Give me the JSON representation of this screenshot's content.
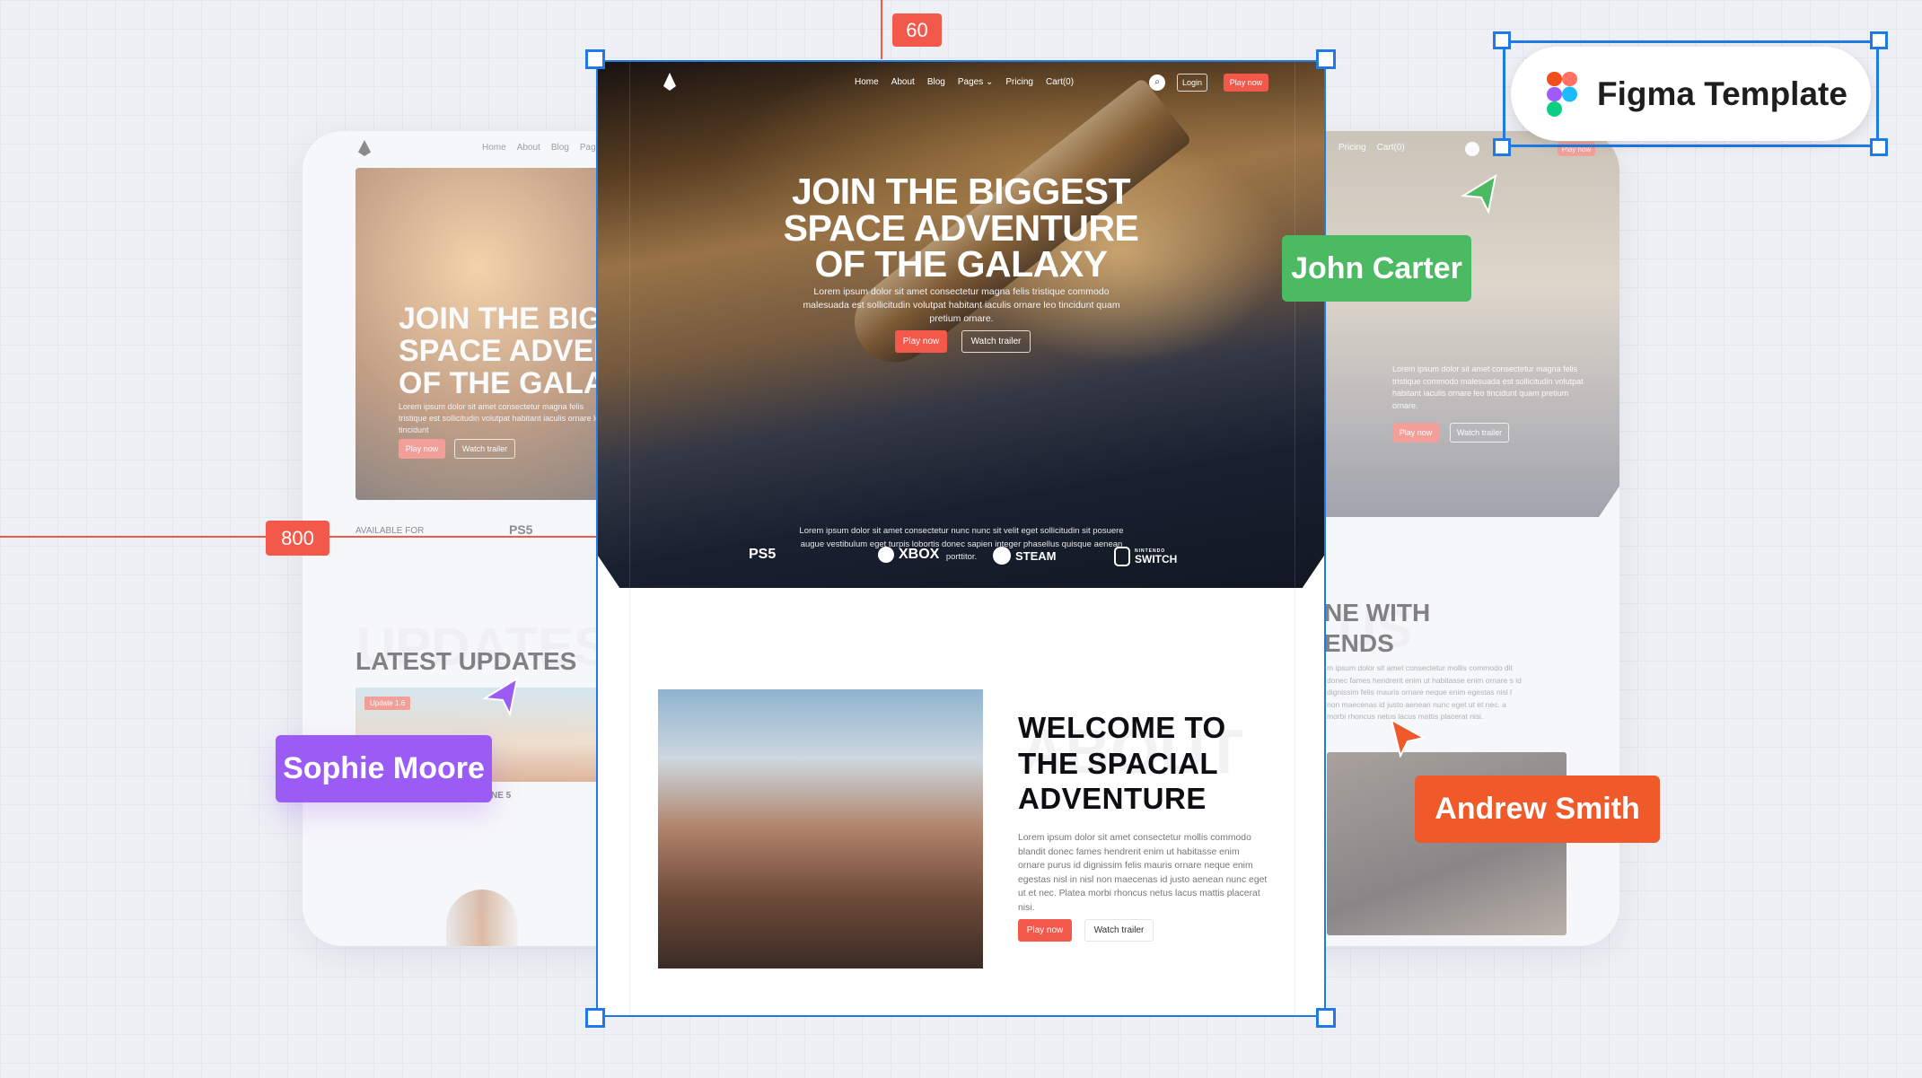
{
  "colors": {
    "accent": "#f2594b",
    "selection": "#1f7ae6",
    "john": "#4cb963",
    "sophie": "#9b5cf6",
    "andrew": "#f0592a"
  },
  "guides": {
    "top_distance": "60",
    "left_distance": "800"
  },
  "badge": {
    "label": "Figma Template",
    "icon": "figma-logo"
  },
  "main": {
    "nav": {
      "logo": "rocket-logo",
      "links": [
        "Home",
        "About",
        "Blog",
        "Pages",
        "Pricing",
        "Cart(0)"
      ],
      "search_icon": "search-icon",
      "login": "Login",
      "play": "Play now"
    },
    "hero": {
      "title_lines": [
        "JOIN THE BIGGEST",
        "SPACE ADVENTURE",
        "OF THE GALAXY"
      ],
      "text": "Lorem ipsum dolor sit amet consectetur magna felis tristique commodo malesuada est sollicitudin volutpat habitant iaculis ornare leo tincidunt quam pretium ornare.",
      "play": "Play now",
      "trailer": "Watch trailer"
    },
    "platforms": [
      "PS5",
      "XBOX",
      "STEAM",
      "SWITCH"
    ],
    "platform_switch_sup": "NINTENDO",
    "platform_text": "Lorem ipsum dolor sit amet consectetur nunc nunc sit velit eget sollicitudin sit posuere augue vestibulum eget turpis lobortis donec sapien integer phasellus quisque aenean porttitor.",
    "about": {
      "ghost": "ABOUT",
      "title_lines": [
        "WELCOME TO",
        "THE SPACIAL",
        "ADVENTURE"
      ],
      "text": "Lorem ipsum dolor sit amet consectetur mollis commodo blandit donec fames hendrerit enim ut habitasse enim ornare purus id dignissim felis mauris ornare neque enim egestas nisl in nisl non maecenas id justo aenean nunc eget ut et nec. Platea morbi rhoncus netus lacus mattis placerat nisi.",
      "play": "Play now",
      "trailer": "Watch trailer"
    }
  },
  "left": {
    "nav": [
      "Home",
      "About",
      "Blog",
      "Pages"
    ],
    "title_lines": [
      "JOIN THE BIGGEST",
      "SPACE ADVENTURE",
      "OF THE GALAXY"
    ],
    "text": "Lorem ipsum dolor sit amet consectetur magna felis tristique est sollicitudin volutpat habitant iaculis ornare leo tincidunt",
    "play": "Play now",
    "trailer": "Watch trailer",
    "available": "AVAILABLE FOR",
    "ghost": "UPDATES",
    "updates_title": "LATEST UPDATES",
    "update_tag": "Update 1.6",
    "update_caption": "NE 5"
  },
  "right": {
    "nav": [
      "Pricing",
      "Cart(0)"
    ],
    "play_nav": "Play now",
    "text": "Lorem ipsum dolor sit amet consectetur magna felis tristique commodo malesuada est sollicitudin volutpat habitant iaculis ornare leo tincidunt quam pretium ornare.",
    "play": "Play now",
    "trailer": "Watch trailer",
    "ghost": "US",
    "title_lines": [
      "NE WITH",
      "ENDS"
    ],
    "text2": "m ipsum dolor sit amet consectetur mollis commodo dit donec fames hendrerit enim ut habitasse enim ornare s id dignissim felis mauris ornare neque enim egestas nisl l non maecenas id justo aenean nunc eget ut et nec. a morbi rhoncus netus lacus mattis placerat nisi."
  },
  "collaborators": [
    {
      "name": "John Carter"
    },
    {
      "name": "Sophie Moore"
    },
    {
      "name": "Andrew Smith"
    }
  ]
}
